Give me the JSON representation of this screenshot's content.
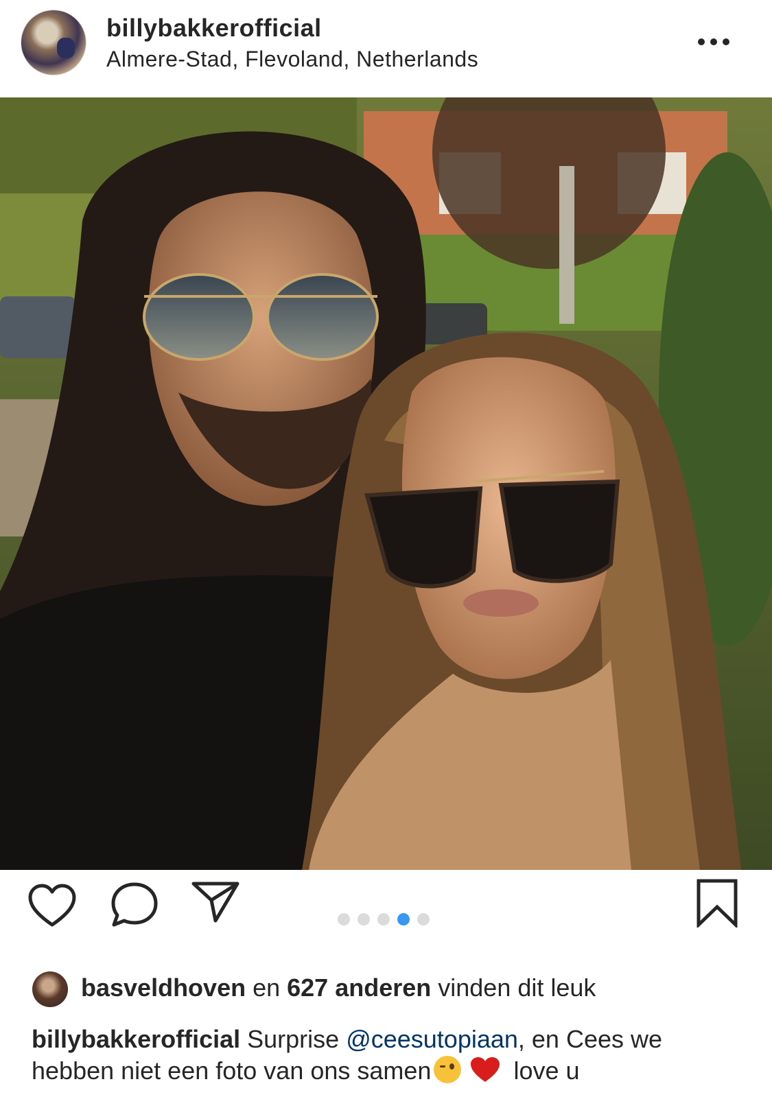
{
  "post": {
    "username": "billybakkerofficial",
    "location": "Almere-Stad, Flevoland, Netherlands"
  },
  "carousel": {
    "count": 5,
    "active_index": 3,
    "active_color": "#3897f0",
    "inactive_color": "#dbdbdb"
  },
  "likes": {
    "first_liker": "basveldhoven",
    "connector": " en ",
    "others": "627 anderen",
    "suffix": " vinden dit leuk"
  },
  "caption": {
    "username": "billybakkerofficial",
    "text_before": " Surprise ",
    "mention": "@ceesutopiaan",
    "text_after": ", en Cees we hebben niet een foto van ons samen",
    "text_end": " love u"
  },
  "icons": {
    "more": "more-options-icon",
    "tag": "user-tag-icon",
    "like": "heart-icon",
    "comment": "comment-icon",
    "share": "share-paper-plane-icon",
    "save": "bookmark-icon"
  }
}
